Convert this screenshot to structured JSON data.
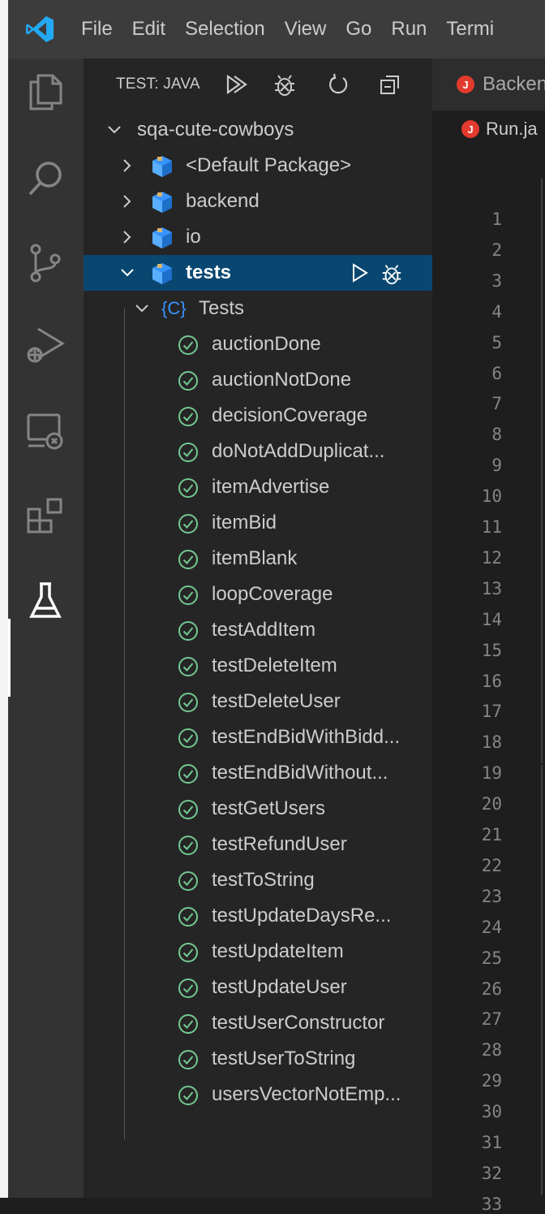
{
  "menu": [
    "File",
    "Edit",
    "Selection",
    "View",
    "Go",
    "Run",
    "Termi"
  ],
  "sidebar": {
    "title": "TEST: JAVA",
    "workspace": "sqa-cute-cowboys",
    "packages": [
      {
        "label": "<Default Package>"
      },
      {
        "label": "backend"
      },
      {
        "label": "io"
      },
      {
        "label": "tests"
      }
    ],
    "class_label": "Tests",
    "class_icon_text": "{C}",
    "tests": [
      "auctionDone",
      "auctionNotDone",
      "decisionCoverage",
      "doNotAddDuplicat...",
      "itemAdvertise",
      "itemBid",
      "itemBlank",
      "loopCoverage",
      "testAddItem",
      "testDeleteItem",
      "testDeleteUser",
      "testEndBidWithBidd...",
      "testEndBidWithout...",
      "testGetUsers",
      "testRefundUser",
      "testToString",
      "testUpdateDaysRe...",
      "testUpdateItem",
      "testUpdateUser",
      "testUserConstructor",
      "testUserToString",
      "usersVectorNotEmp..."
    ]
  },
  "editor": {
    "tab_label": "Backen",
    "breadcrumb": "Run.ja",
    "file_icon_text": "J",
    "line_numbers": [
      "1",
      "2",
      "3",
      "4",
      "5",
      "6",
      "7",
      "8",
      "9",
      "10",
      "11",
      "12",
      "13",
      "14",
      "15",
      "16",
      "17",
      "18",
      "19",
      "20",
      "21",
      "22",
      "23",
      "24",
      "25",
      "26",
      "27",
      "28",
      "29",
      "30",
      "31",
      "32",
      "33"
    ]
  },
  "colors": {
    "accent_vscode": "#23a9f2",
    "selected_row": "#094771",
    "pass_green": "#73c991",
    "package_blue": "#3794ff",
    "java_red": "#e23a2d"
  }
}
